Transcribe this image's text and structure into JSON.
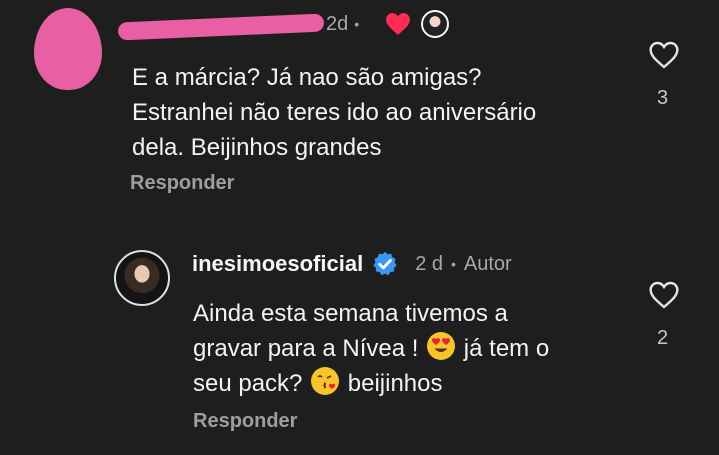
{
  "comment": {
    "time": "2d",
    "separator": "•",
    "text_lines": [
      "E a márcia? Já nao são amigas?",
      "Estranhei não teres ido ao aniversário",
      "dela. Beijinhos grandes"
    ],
    "reply_label": "Responder",
    "like_count": "3",
    "liked_icon": "heart-filled-red",
    "author_like_avatar_icon": "creator-avatar"
  },
  "reply": {
    "username": "inesimoesoficial",
    "verified_icon": "verified-badge-blue",
    "time": "2 d",
    "separator": "•",
    "author_tag": "Autor",
    "line1": "Ainda esta semana tivemos a",
    "line2_before": "gravar para a Nívea !",
    "line2_after": "já tem o",
    "line3_before": "seu pack?",
    "line3_after": "beijinhos",
    "emoji_1": "heart-eyes-emoji",
    "emoji_2": "kissing-heart-emoji",
    "reply_label": "Responder",
    "like_count": "2"
  },
  "colors": {
    "background": "#1e1e1f",
    "accent_pink_redaction": "#e85fa3",
    "heart_red": "#ff2d55",
    "verified_blue": "#3897f0"
  }
}
